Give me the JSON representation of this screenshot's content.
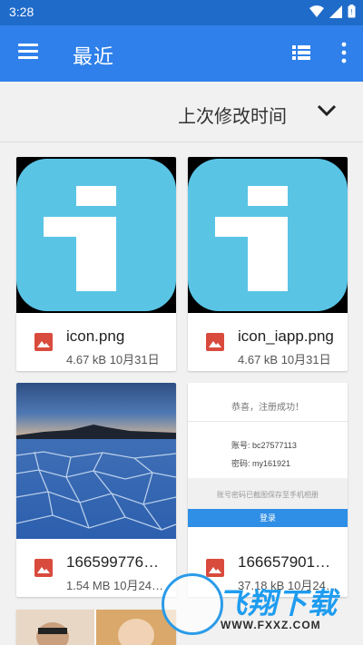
{
  "status": {
    "time": "3:28"
  },
  "appbar": {
    "title": "最近"
  },
  "sort": {
    "label": "上次修改时间"
  },
  "files": [
    {
      "name": "icon.png",
      "info": "4.67 kB 10月31日"
    },
    {
      "name": "icon_iapp.png",
      "info": "4.67 kB 10月31日"
    },
    {
      "name": "166599776…",
      "info": "1.54 MB 10月24…"
    },
    {
      "name": "166657901…",
      "info": "37.18 kB 10月24…"
    }
  ],
  "login_screenshot": {
    "title": "恭喜，注册成功！",
    "account_row": "账号:   bc27577113",
    "password_row": "密码:   my161921",
    "note": "账号密码已截图保存至手机相册",
    "button": "登录"
  },
  "watermark": {
    "brand": "飞翔下载",
    "url": "WWW.FXXZ.COM"
  },
  "colors": {
    "statusbar": "#1f6bc9",
    "appbar": "#2f80ea",
    "icon_blue": "#5ac4e5",
    "image_icon_red": "#d94b3d"
  }
}
